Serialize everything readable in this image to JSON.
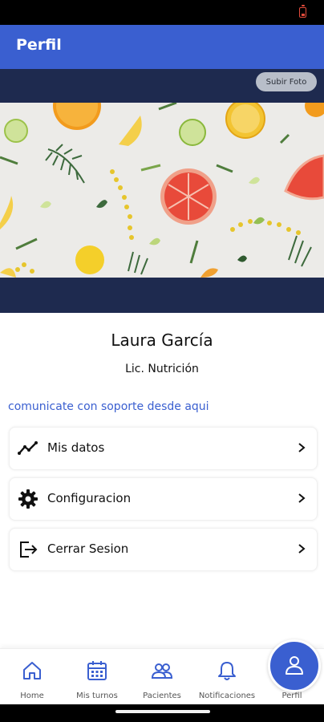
{
  "app_bar": {
    "title": "Perfil"
  },
  "cover": {
    "upload_label": "Subir Foto"
  },
  "profile": {
    "name": "Laura García",
    "role": "Lic. Nutrición",
    "support_text": "comunicate con soporte desde aqui"
  },
  "menu": [
    {
      "label": "Mis datos",
      "icon": "chart-line-icon"
    },
    {
      "label": "Configuracion",
      "icon": "gear-icon"
    },
    {
      "label": "Cerrar Sesion",
      "icon": "logout-icon"
    }
  ],
  "bottom_nav": [
    {
      "label": "Home",
      "icon": "home-icon"
    },
    {
      "label": "Mis turnos",
      "icon": "calendar-icon"
    },
    {
      "label": "Pacientes",
      "icon": "people-icon"
    },
    {
      "label": "Notificaciones",
      "icon": "bell-icon"
    },
    {
      "label": "Perfil",
      "icon": "user-icon",
      "active": true
    }
  ],
  "colors": {
    "primary": "#3a5fd0",
    "cover_bg": "#1e2a4f",
    "status_bar": "#000000",
    "battery": "#e24b3b"
  }
}
